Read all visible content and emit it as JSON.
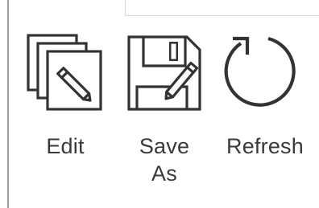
{
  "toolbar": {
    "edit_label": "Edit",
    "save_as_label_line1": "Save",
    "save_as_label_line2": "As",
    "refresh_label": "Refresh"
  },
  "icons": {
    "edit": "edit-stack-icon",
    "save_as": "save-as-icon",
    "refresh": "refresh-icon"
  },
  "colors": {
    "icon_stroke": "#333333",
    "label_text": "#3a3a3a"
  }
}
